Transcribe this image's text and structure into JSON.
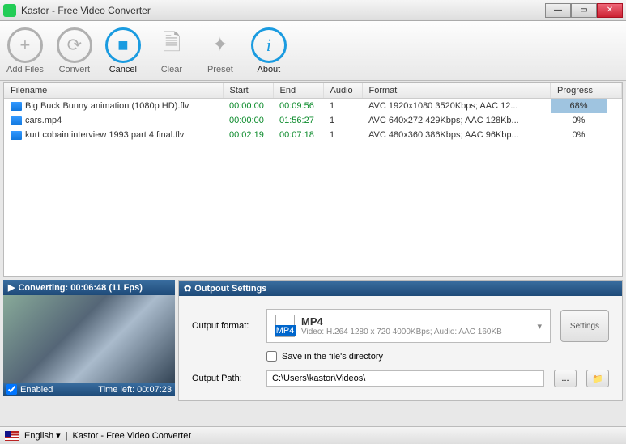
{
  "window": {
    "title": "Kastor - Free Video Converter"
  },
  "toolbar": {
    "addFiles": "Add Files",
    "convert": "Convert",
    "cancel": "Cancel",
    "clear": "Clear",
    "preset": "Preset",
    "about": "About"
  },
  "columns": {
    "filename": "Filename",
    "start": "Start",
    "end": "End",
    "audio": "Audio",
    "format": "Format",
    "progress": "Progress"
  },
  "rows": [
    {
      "filename": "Big Buck Bunny animation (1080p HD).flv",
      "start": "00:00:00",
      "end": "00:09:56",
      "audio": "1",
      "format": "AVC 1920x1080 3520Kbps; AAC 12...",
      "progress": "68%",
      "highlight": true
    },
    {
      "filename": "cars.mp4",
      "start": "00:00:00",
      "end": "01:56:27",
      "audio": "1",
      "format": "AVC 640x272 429Kbps; AAC 128Kb...",
      "progress": "0%",
      "highlight": false
    },
    {
      "filename": "kurt cobain interview 1993 part 4 final.flv",
      "start": "00:02:19",
      "end": "00:07:18",
      "audio": "1",
      "format": "AVC 480x360 386Kbps; AAC 96Kbp...",
      "progress": "0%",
      "highlight": false
    }
  ],
  "preview": {
    "header": "Converting: 00:06:48 (11 Fps)",
    "enabled": "Enabled",
    "timeleft": "Time left: 00:07:23"
  },
  "settings": {
    "header": "Outpout Settings",
    "outputFormatLabel": "Output format:",
    "fmtName": "MP4",
    "fmtDesc": "Video: H.264 1280 x 720 4000KBps; Audio: AAC 160KB",
    "settingsBtn": "Settings",
    "saveInDir": "Save in the file's directory",
    "outputPathLabel": "Output Path:",
    "outputPath": "C:\\Users\\kastor\\Videos\\"
  },
  "statusbar": {
    "lang": "English",
    "appname": "Kastor - Free Video Converter"
  }
}
